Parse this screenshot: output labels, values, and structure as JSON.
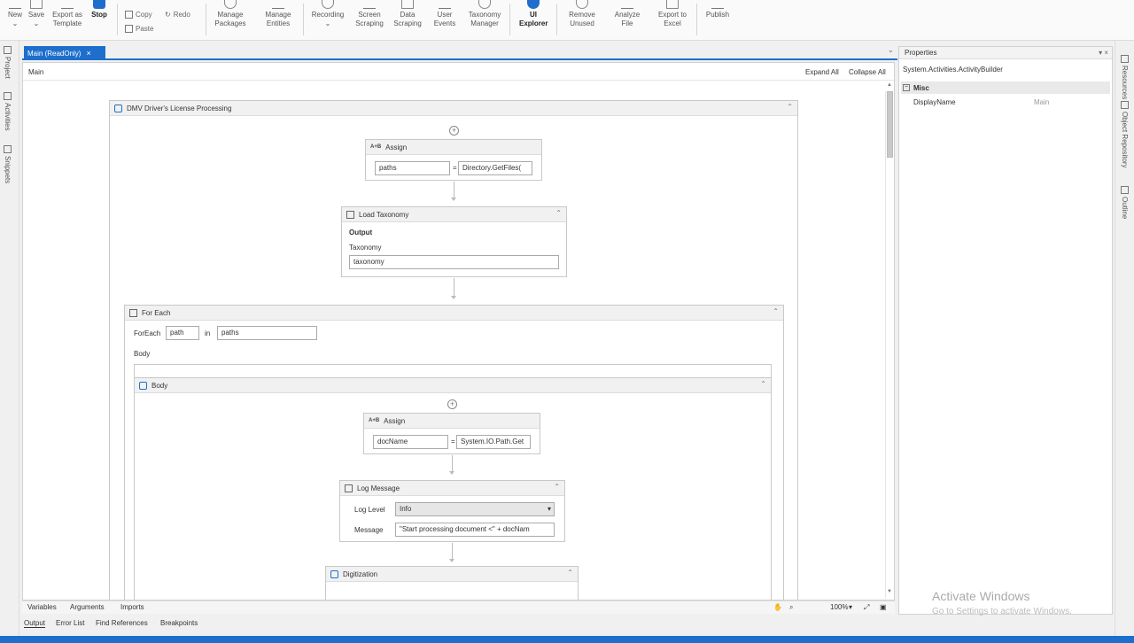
{
  "ribbon": {
    "new": "New",
    "save": "Save",
    "export_template": "Export as Template",
    "stop": "Stop",
    "copy": "Copy",
    "redo": "Redo",
    "paste": "Paste",
    "manage_packages": "Manage Packages",
    "manage_entities": "Manage Entities",
    "recording": "Recording",
    "screen_scraping": "Screen Scraping",
    "data_scraping": "Data Scraping",
    "user_events": "User Events",
    "taxonomy_manager": "Taxonomy Manager",
    "ui_explorer": "UI Explorer",
    "remove_unused": "Remove Unused",
    "analyze_file": "Analyze File",
    "export_excel": "Export to Excel",
    "publish": "Publish"
  },
  "left_rail": {
    "project": "Project",
    "activities": "Activities",
    "snippets": "Snippets"
  },
  "right_rail": {
    "resources": "Resources",
    "object_repository": "Object Repository",
    "outline": "Outline"
  },
  "tab": {
    "label": "Main (ReadOnly)",
    "close": "×"
  },
  "designer": {
    "breadcrumb": "Main",
    "expand_all": "Expand All",
    "collapse_all": "Collapse All",
    "root_title": "DMV Driver's License Processing",
    "assign1": {
      "title": "Assign",
      "to": "paths",
      "value": "Directory.GetFiles("
    },
    "load_taxonomy": {
      "title": "Load Taxonomy",
      "output": "Output",
      "taxonomy_label": "Taxonomy",
      "taxonomy_value": "taxonomy"
    },
    "for_each": {
      "title": "For Each",
      "foreach_label": "ForEach",
      "item": "path",
      "in_label": "in",
      "collection": "paths",
      "body_label": "Body"
    },
    "body_seq": {
      "title": "Body"
    },
    "assign2": {
      "title": "Assign",
      "to": "docName",
      "value": "System.IO.Path.Get"
    },
    "log_message": {
      "title": "Log Message",
      "level_label": "Log Level",
      "level": "Info",
      "message_label": "Message",
      "message": "\"Start processing document <\" + docNam"
    },
    "digitization": {
      "title": "Digitization"
    }
  },
  "bottom": {
    "variables": "Variables",
    "arguments": "Arguments",
    "imports": "Imports",
    "zoom": "100%",
    "output": "Output",
    "error_list": "Error List",
    "find_references": "Find References",
    "breakpoints": "Breakpoints"
  },
  "properties": {
    "title": "Properties",
    "type": "System.Activities.ActivityBuilder",
    "category": "Misc",
    "prop_name": "DisplayName",
    "prop_value": "Main"
  },
  "watermark": {
    "line1": "Activate Windows",
    "line2": "Go to Settings to activate Windows."
  }
}
